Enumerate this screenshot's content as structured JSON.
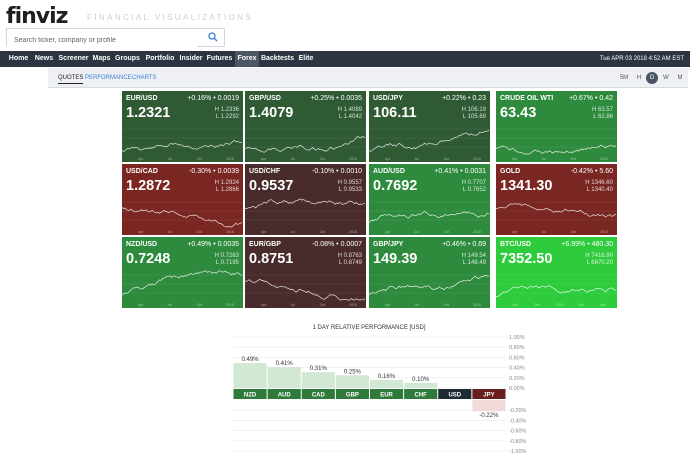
{
  "header": {
    "logo": "finviz",
    "tagline": "FINANCIAL VISUALIZATIONS",
    "search_placeholder": "Search ticker, company or profile"
  },
  "nav": {
    "items": [
      "Home",
      "News",
      "Screener",
      "Maps",
      "Groups",
      "Portfolio",
      "Insider",
      "Futures",
      "Forex",
      "Backtests",
      "Elite"
    ],
    "active": "Forex",
    "datetime": "Tue APR 03 2018 4:52 AM EST"
  },
  "subnav": {
    "tabs": [
      "QUOTES",
      "PERFORMANCE",
      "CHARTS"
    ],
    "active": "QUOTES",
    "timeframes": [
      "5M",
      "H",
      "D",
      "W",
      "M"
    ],
    "active_timeframe": "D"
  },
  "tiles": [
    {
      "symbol": "EUR/USD",
      "change": "+0.16% • 0.0019",
      "price": "1.2321",
      "high": "H 1.2336",
      "low": "L 1.2292",
      "tone": "up-dark",
      "axis": [
        "Apr",
        "Jul",
        "Oct",
        "2018"
      ]
    },
    {
      "symbol": "GBP/USD",
      "change": "+0.25% • 0.0035",
      "price": "1.4079",
      "high": "H 1.4089",
      "low": "L 1.4042",
      "tone": "up-dark",
      "axis": [
        "Apr",
        "Jul",
        "Oct",
        "2018"
      ]
    },
    {
      "symbol": "USD/JPY",
      "change": "+0.22% • 0.23",
      "price": "106.11",
      "high": "H 106.19",
      "low": "L 105.69",
      "tone": "up-dark",
      "axis": [
        "Apr",
        "Jul",
        "Oct",
        "2018"
      ]
    },
    {
      "symbol": "CRUDE OIL WTI",
      "change": "+0.67% • 0.42",
      "price": "63.43",
      "high": "H 63.57",
      "low": "L 62.86",
      "tone": "up-mid",
      "axis": [
        "Apr",
        "Jul",
        "Oct",
        "2018"
      ]
    },
    {
      "symbol": "USD/CAD",
      "change": "-0.30% • 0.0039",
      "price": "1.2872",
      "high": "H 1.2924",
      "low": "L 1.2866",
      "tone": "down",
      "axis": [
        "Apr",
        "Jul",
        "Oct",
        "2018"
      ]
    },
    {
      "symbol": "USD/CHF",
      "change": "-0.10% • 0.0010",
      "price": "0.9537",
      "high": "H 0.9557",
      "low": "L 0.9533",
      "tone": "down-dark",
      "axis": [
        "Apr",
        "Jul",
        "Oct",
        "2018"
      ]
    },
    {
      "symbol": "AUD/USD",
      "change": "+0.41% • 0.0031",
      "price": "0.7692",
      "high": "H 0.7707",
      "low": "L 0.7652",
      "tone": "up-mid",
      "axis": [
        "Apr",
        "Jul",
        "Oct",
        "2018"
      ]
    },
    {
      "symbol": "GOLD",
      "change": "-0.42% • 5.60",
      "price": "1341.30",
      "high": "H 1346.60",
      "low": "L 1340.40",
      "tone": "down",
      "axis": [
        "Apr",
        "Jul",
        "Oct",
        "2018"
      ]
    },
    {
      "symbol": "NZD/USD",
      "change": "+0.49% • 0.0035",
      "price": "0.7248",
      "high": "H 0.7263",
      "low": "L 0.7195",
      "tone": "up-mid",
      "axis": [
        "Apr",
        "Jul",
        "Oct",
        "2018"
      ]
    },
    {
      "symbol": "EUR/GBP",
      "change": "-0.08% • 0.0007",
      "price": "0.8751",
      "high": "H 0.8763",
      "low": "L 0.8749",
      "tone": "down-dark",
      "axis": [
        "Apr",
        "Jul",
        "Oct",
        "2018"
      ]
    },
    {
      "symbol": "GBP/JPY",
      "change": "+0.46% • 0.69",
      "price": "149.39",
      "high": "H 149.54",
      "low": "L 148.49",
      "tone": "up-mid",
      "axis": [
        "Apr",
        "Jul",
        "Oct",
        "2018"
      ]
    },
    {
      "symbol": "BTC/USD",
      "change": "+6.99% • 480.30",
      "price": "7352.50",
      "high": "H 7416.90",
      "low": "L 6870.20",
      "tone": "up-bright",
      "axis": [
        "Nov",
        "Dec",
        "2018",
        "Feb",
        "Mar"
      ]
    }
  ],
  "colors": {
    "up-dark": "#2f5a34",
    "up-mid": "#2e8b3e",
    "up-bright": "#2ecc3c",
    "down": "#7a2622",
    "down-dark": "#4a2b2b",
    "bar_positive": "#d3e8d3",
    "bar_negative": "#f0dada",
    "label_positive": "#2f7a3a",
    "label_negative": "#6a1f1f",
    "label_neutral": "#1f2a33",
    "value_positive": "#2f7a3a",
    "value_negative": "#a12a2a"
  },
  "chart_data": {
    "type": "bar",
    "title": "1 DAY RELATIVE PERFORMANCE [USD]",
    "categories": [
      "NZD",
      "AUD",
      "CAD",
      "GBP",
      "EUR",
      "CHF",
      "USD",
      "JPY"
    ],
    "values": [
      0.49,
      0.41,
      0.31,
      0.25,
      0.16,
      0.1,
      0.0,
      -0.22
    ],
    "value_labels": [
      "0.49%",
      "0.41%",
      "0.31%",
      "0.25%",
      "0.16%",
      "0.10%",
      "",
      "-0.22%"
    ],
    "ylim": [
      -1.0,
      1.0
    ],
    "yticks": [
      "1.00%",
      "0.80%",
      "0.60%",
      "0.40%",
      "0.20%",
      "0.00%",
      "-0.20%",
      "-0.40%",
      "-0.60%",
      "-0.80%",
      "-1.00%"
    ],
    "grid": true
  }
}
